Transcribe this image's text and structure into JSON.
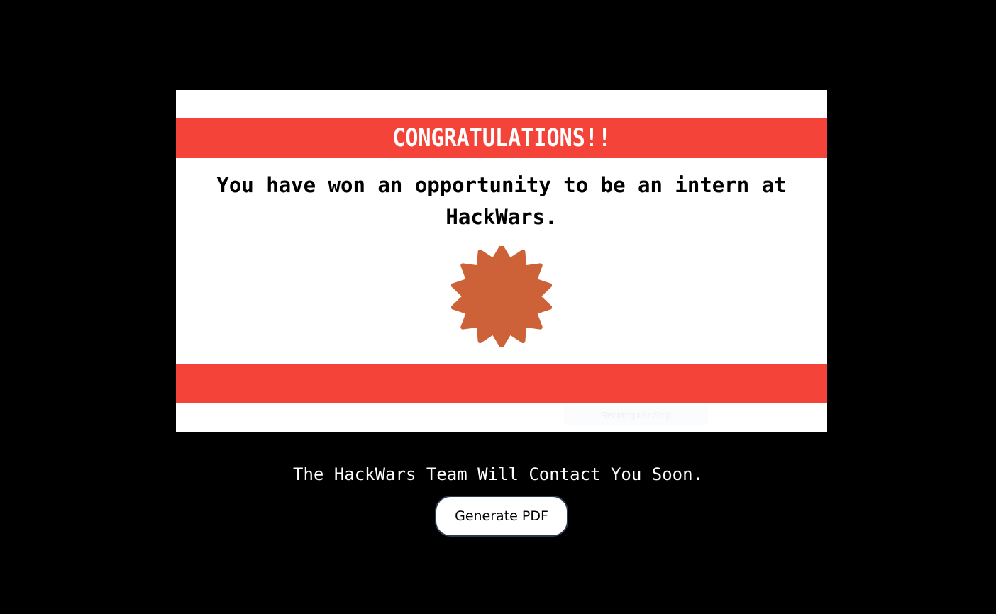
{
  "certificate": {
    "headline": "CONGRATULATIONS!!",
    "message": "You have won an opportunity to be an intern at HackWars.",
    "badge_icon": "starburst-seal-icon",
    "band_color": "#f4443a",
    "badge_color": "#cd6137",
    "snip_hint": "Rectangular Snip"
  },
  "footer": {
    "message": "The HackWars Team Will Contact You Soon.",
    "generate_button_label": "Generate PDF"
  }
}
